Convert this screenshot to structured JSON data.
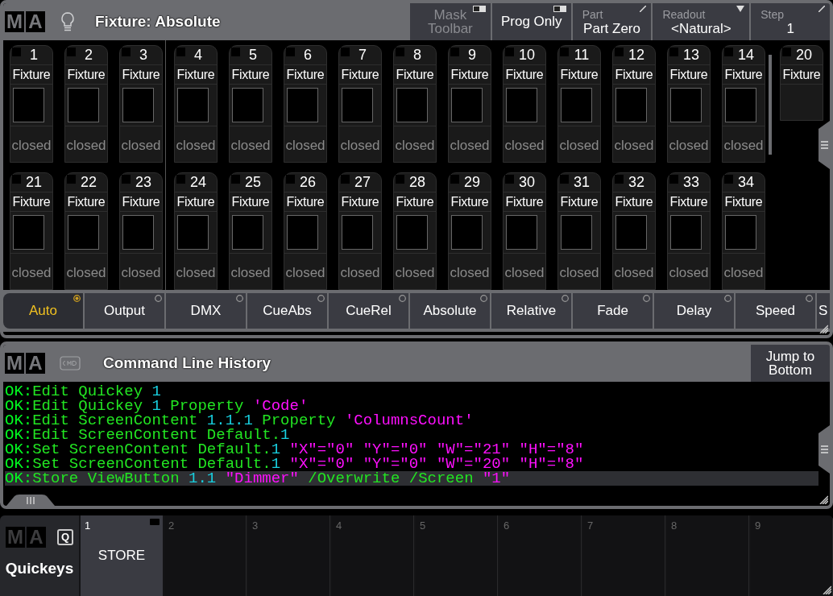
{
  "fixture_window": {
    "logo": [
      "M",
      "A"
    ],
    "title": "Fixture: Absolute",
    "toolbar": [
      {
        "kind": "toggle",
        "label": "Mask Toolbar",
        "disabled": true
      },
      {
        "kind": "toggle",
        "label": "Prog Only",
        "disabled": false
      },
      {
        "kind": "edit",
        "caption": "Part",
        "label": "Part Zero",
        "disabled": false
      },
      {
        "kind": "dropdown",
        "caption": "Readout",
        "label": "<Natural>",
        "disabled": false
      },
      {
        "kind": "edit",
        "caption": "Step",
        "label": "1",
        "disabled": false
      }
    ],
    "rows": [
      [
        {
          "kind": "full",
          "number": "1",
          "name": "Fixture",
          "state": "closed"
        },
        {
          "kind": "full",
          "number": "2",
          "name": "Fixture",
          "state": "closed"
        },
        {
          "kind": "full",
          "number": "3",
          "name": "Fixture",
          "state": "closed"
        },
        {
          "kind": "full",
          "number": "4",
          "name": "Fixture",
          "state": "closed"
        },
        {
          "kind": "full",
          "number": "5",
          "name": "Fixture",
          "state": "closed"
        },
        {
          "kind": "full",
          "number": "6",
          "name": "Fixture",
          "state": "closed"
        },
        {
          "kind": "full",
          "number": "7",
          "name": "Fixture",
          "state": "closed"
        },
        {
          "kind": "full",
          "number": "8",
          "name": "Fixture",
          "state": "closed"
        },
        {
          "kind": "full",
          "number": "9",
          "name": "Fixture",
          "state": "closed"
        },
        {
          "kind": "full",
          "number": "10",
          "name": "Fixture",
          "state": "closed"
        },
        {
          "kind": "full",
          "number": "11",
          "name": "Fixture",
          "state": "closed"
        },
        {
          "kind": "full",
          "number": "12",
          "name": "Fixture",
          "state": "closed"
        },
        {
          "kind": "full",
          "number": "13",
          "name": "Fixture",
          "state": "closed"
        },
        {
          "kind": "full",
          "number": "14",
          "name": "Fixture",
          "state": "closed"
        },
        {
          "kind": "compact",
          "number": "20",
          "name": "Fixture"
        }
      ],
      [
        {
          "kind": "full",
          "number": "21",
          "name": "Fixture",
          "state": "closed"
        },
        {
          "kind": "full",
          "number": "22",
          "name": "Fixture",
          "state": "closed"
        },
        {
          "kind": "full",
          "number": "23",
          "name": "Fixture",
          "state": "closed"
        },
        {
          "kind": "full",
          "number": "24",
          "name": "Fixture",
          "state": "closed"
        },
        {
          "kind": "full",
          "number": "25",
          "name": "Fixture",
          "state": "closed"
        },
        {
          "kind": "full",
          "number": "26",
          "name": "Fixture",
          "state": "closed"
        },
        {
          "kind": "full",
          "number": "27",
          "name": "Fixture",
          "state": "closed"
        },
        {
          "kind": "full",
          "number": "28",
          "name": "Fixture",
          "state": "closed"
        },
        {
          "kind": "full",
          "number": "29",
          "name": "Fixture",
          "state": "closed"
        },
        {
          "kind": "full",
          "number": "30",
          "name": "Fixture",
          "state": "closed"
        },
        {
          "kind": "full",
          "number": "31",
          "name": "Fixture",
          "state": "closed"
        },
        {
          "kind": "full",
          "number": "32",
          "name": "Fixture",
          "state": "closed"
        },
        {
          "kind": "full",
          "number": "33",
          "name": "Fixture",
          "state": "closed"
        },
        {
          "kind": "full",
          "number": "34",
          "name": "Fixture",
          "state": "closed"
        }
      ]
    ],
    "tabs": [
      {
        "label": "Auto",
        "selected": true
      },
      {
        "label": "Output",
        "selected": false
      },
      {
        "label": "DMX",
        "selected": false
      },
      {
        "label": "CueAbs",
        "selected": false
      },
      {
        "label": "CueRel",
        "selected": false
      },
      {
        "label": "Absolute",
        "selected": false
      },
      {
        "label": "Relative",
        "selected": false
      },
      {
        "label": "Fade",
        "selected": false
      },
      {
        "label": "Delay",
        "selected": false
      },
      {
        "label": "Speed",
        "selected": false
      },
      {
        "label": "S",
        "selected": false
      }
    ]
  },
  "command_window": {
    "logo": [
      "M",
      "A"
    ],
    "title": "Command Line History",
    "jump_button": "Jump to Bottom",
    "lines": [
      {
        "selected": false,
        "segments": [
          {
            "kind": "ok",
            "text": "OK:"
          },
          {
            "kind": "cmd",
            "text": "Edit Quickey "
          },
          {
            "kind": "number",
            "text": "1"
          }
        ]
      },
      {
        "selected": false,
        "segments": [
          {
            "kind": "ok",
            "text": "OK:"
          },
          {
            "kind": "cmd",
            "text": "Edit Quickey "
          },
          {
            "kind": "number",
            "text": "1"
          },
          {
            "kind": "cmd",
            "text": " Property "
          },
          {
            "kind": "string",
            "text": "'Code'"
          }
        ]
      },
      {
        "selected": false,
        "segments": [
          {
            "kind": "ok",
            "text": "OK:"
          },
          {
            "kind": "cmd",
            "text": "Edit ScreenContent "
          },
          {
            "kind": "number",
            "text": "1.1.1"
          },
          {
            "kind": "cmd",
            "text": " Property "
          },
          {
            "kind": "string",
            "text": "'ColumnsCount'"
          }
        ]
      },
      {
        "selected": false,
        "segments": [
          {
            "kind": "ok",
            "text": "OK:"
          },
          {
            "kind": "cmd",
            "text": "Edit ScreenContent Default."
          },
          {
            "kind": "number",
            "text": "1"
          }
        ]
      },
      {
        "selected": false,
        "segments": [
          {
            "kind": "ok",
            "text": "OK:"
          },
          {
            "kind": "cmd",
            "text": "Set ScreenContent Default."
          },
          {
            "kind": "number",
            "text": "1"
          },
          {
            "kind": "string",
            "text": " \"X\"=\"0\" \"Y\"=\"0\" \"W\"=\"21\" \"H\"=\"8\""
          }
        ]
      },
      {
        "selected": false,
        "segments": [
          {
            "kind": "ok",
            "text": "OK:"
          },
          {
            "kind": "cmd",
            "text": "Set ScreenContent Default."
          },
          {
            "kind": "number",
            "text": "1"
          },
          {
            "kind": "string",
            "text": " \"X\"=\"0\" \"Y\"=\"0\" \"W\"=\"20\" \"H\"=\"8\""
          }
        ]
      },
      {
        "selected": true,
        "segments": [
          {
            "kind": "ok",
            "text": "OK:"
          },
          {
            "kind": "cmd",
            "text": "Store ViewButton "
          },
          {
            "kind": "number",
            "text": "1.1"
          },
          {
            "kind": "string",
            "text": " \"Dimmer\""
          },
          {
            "kind": "cmd",
            "text": " /Overwrite /Screen "
          },
          {
            "kind": "string",
            "text": "\"1\""
          }
        ]
      }
    ]
  },
  "quickeys_bar": {
    "logo": [
      "M",
      "A"
    ],
    "icon_letter": "Q",
    "title": "Quickeys",
    "keys": [
      {
        "number": "1",
        "label": "STORE",
        "assigned": true
      },
      {
        "number": "2",
        "assigned": false
      },
      {
        "number": "3",
        "assigned": false
      },
      {
        "number": "4",
        "assigned": false
      },
      {
        "number": "5",
        "assigned": false
      },
      {
        "number": "6",
        "assigned": false
      },
      {
        "number": "7",
        "assigned": false
      },
      {
        "number": "8",
        "assigned": false
      },
      {
        "number": "9",
        "assigned": false
      }
    ]
  }
}
